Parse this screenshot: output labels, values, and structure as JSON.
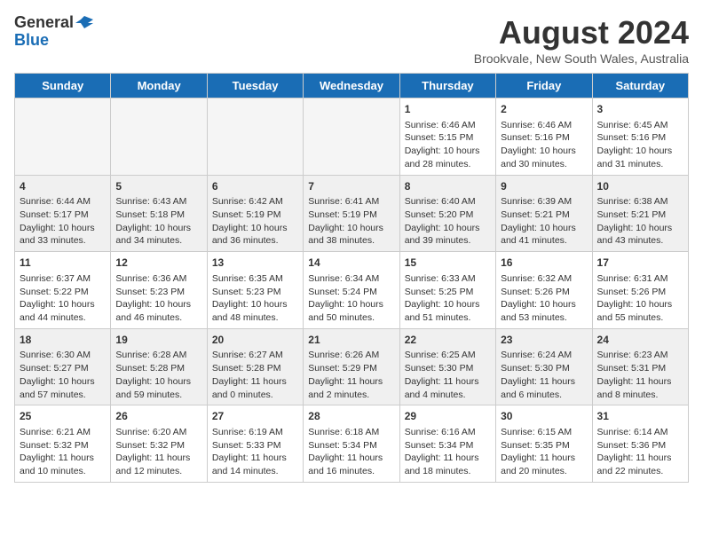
{
  "header": {
    "logo_general": "General",
    "logo_blue": "Blue",
    "title": "August 2024",
    "location": "Brookvale, New South Wales, Australia"
  },
  "days_of_week": [
    "Sunday",
    "Monday",
    "Tuesday",
    "Wednesday",
    "Thursday",
    "Friday",
    "Saturday"
  ],
  "weeks": [
    [
      {
        "day": "",
        "empty": true
      },
      {
        "day": "",
        "empty": true
      },
      {
        "day": "",
        "empty": true
      },
      {
        "day": "",
        "empty": true
      },
      {
        "day": "1",
        "sunrise": "6:46 AM",
        "sunset": "5:15 PM",
        "daylight": "10 hours and 28 minutes."
      },
      {
        "day": "2",
        "sunrise": "6:46 AM",
        "sunset": "5:16 PM",
        "daylight": "10 hours and 30 minutes."
      },
      {
        "day": "3",
        "sunrise": "6:45 AM",
        "sunset": "5:16 PM",
        "daylight": "10 hours and 31 minutes."
      }
    ],
    [
      {
        "day": "4",
        "sunrise": "6:44 AM",
        "sunset": "5:17 PM",
        "daylight": "10 hours and 33 minutes."
      },
      {
        "day": "5",
        "sunrise": "6:43 AM",
        "sunset": "5:18 PM",
        "daylight": "10 hours and 34 minutes."
      },
      {
        "day": "6",
        "sunrise": "6:42 AM",
        "sunset": "5:19 PM",
        "daylight": "10 hours and 36 minutes."
      },
      {
        "day": "7",
        "sunrise": "6:41 AM",
        "sunset": "5:19 PM",
        "daylight": "10 hours and 38 minutes."
      },
      {
        "day": "8",
        "sunrise": "6:40 AM",
        "sunset": "5:20 PM",
        "daylight": "10 hours and 39 minutes."
      },
      {
        "day": "9",
        "sunrise": "6:39 AM",
        "sunset": "5:21 PM",
        "daylight": "10 hours and 41 minutes."
      },
      {
        "day": "10",
        "sunrise": "6:38 AM",
        "sunset": "5:21 PM",
        "daylight": "10 hours and 43 minutes."
      }
    ],
    [
      {
        "day": "11",
        "sunrise": "6:37 AM",
        "sunset": "5:22 PM",
        "daylight": "10 hours and 44 minutes."
      },
      {
        "day": "12",
        "sunrise": "6:36 AM",
        "sunset": "5:23 PM",
        "daylight": "10 hours and 46 minutes."
      },
      {
        "day": "13",
        "sunrise": "6:35 AM",
        "sunset": "5:23 PM",
        "daylight": "10 hours and 48 minutes."
      },
      {
        "day": "14",
        "sunrise": "6:34 AM",
        "sunset": "5:24 PM",
        "daylight": "10 hours and 50 minutes."
      },
      {
        "day": "15",
        "sunrise": "6:33 AM",
        "sunset": "5:25 PM",
        "daylight": "10 hours and 51 minutes."
      },
      {
        "day": "16",
        "sunrise": "6:32 AM",
        "sunset": "5:26 PM",
        "daylight": "10 hours and 53 minutes."
      },
      {
        "day": "17",
        "sunrise": "6:31 AM",
        "sunset": "5:26 PM",
        "daylight": "10 hours and 55 minutes."
      }
    ],
    [
      {
        "day": "18",
        "sunrise": "6:30 AM",
        "sunset": "5:27 PM",
        "daylight": "10 hours and 57 minutes."
      },
      {
        "day": "19",
        "sunrise": "6:28 AM",
        "sunset": "5:28 PM",
        "daylight": "10 hours and 59 minutes."
      },
      {
        "day": "20",
        "sunrise": "6:27 AM",
        "sunset": "5:28 PM",
        "daylight": "11 hours and 0 minutes."
      },
      {
        "day": "21",
        "sunrise": "6:26 AM",
        "sunset": "5:29 PM",
        "daylight": "11 hours and 2 minutes."
      },
      {
        "day": "22",
        "sunrise": "6:25 AM",
        "sunset": "5:30 PM",
        "daylight": "11 hours and 4 minutes."
      },
      {
        "day": "23",
        "sunrise": "6:24 AM",
        "sunset": "5:30 PM",
        "daylight": "11 hours and 6 minutes."
      },
      {
        "day": "24",
        "sunrise": "6:23 AM",
        "sunset": "5:31 PM",
        "daylight": "11 hours and 8 minutes."
      }
    ],
    [
      {
        "day": "25",
        "sunrise": "6:21 AM",
        "sunset": "5:32 PM",
        "daylight": "11 hours and 10 minutes."
      },
      {
        "day": "26",
        "sunrise": "6:20 AM",
        "sunset": "5:32 PM",
        "daylight": "11 hours and 12 minutes."
      },
      {
        "day": "27",
        "sunrise": "6:19 AM",
        "sunset": "5:33 PM",
        "daylight": "11 hours and 14 minutes."
      },
      {
        "day": "28",
        "sunrise": "6:18 AM",
        "sunset": "5:34 PM",
        "daylight": "11 hours and 16 minutes."
      },
      {
        "day": "29",
        "sunrise": "6:16 AM",
        "sunset": "5:34 PM",
        "daylight": "11 hours and 18 minutes."
      },
      {
        "day": "30",
        "sunrise": "6:15 AM",
        "sunset": "5:35 PM",
        "daylight": "11 hours and 20 minutes."
      },
      {
        "day": "31",
        "sunrise": "6:14 AM",
        "sunset": "5:36 PM",
        "daylight": "11 hours and 22 minutes."
      }
    ]
  ],
  "labels": {
    "sunrise": "Sunrise:",
    "sunset": "Sunset:",
    "daylight": "Daylight:"
  }
}
